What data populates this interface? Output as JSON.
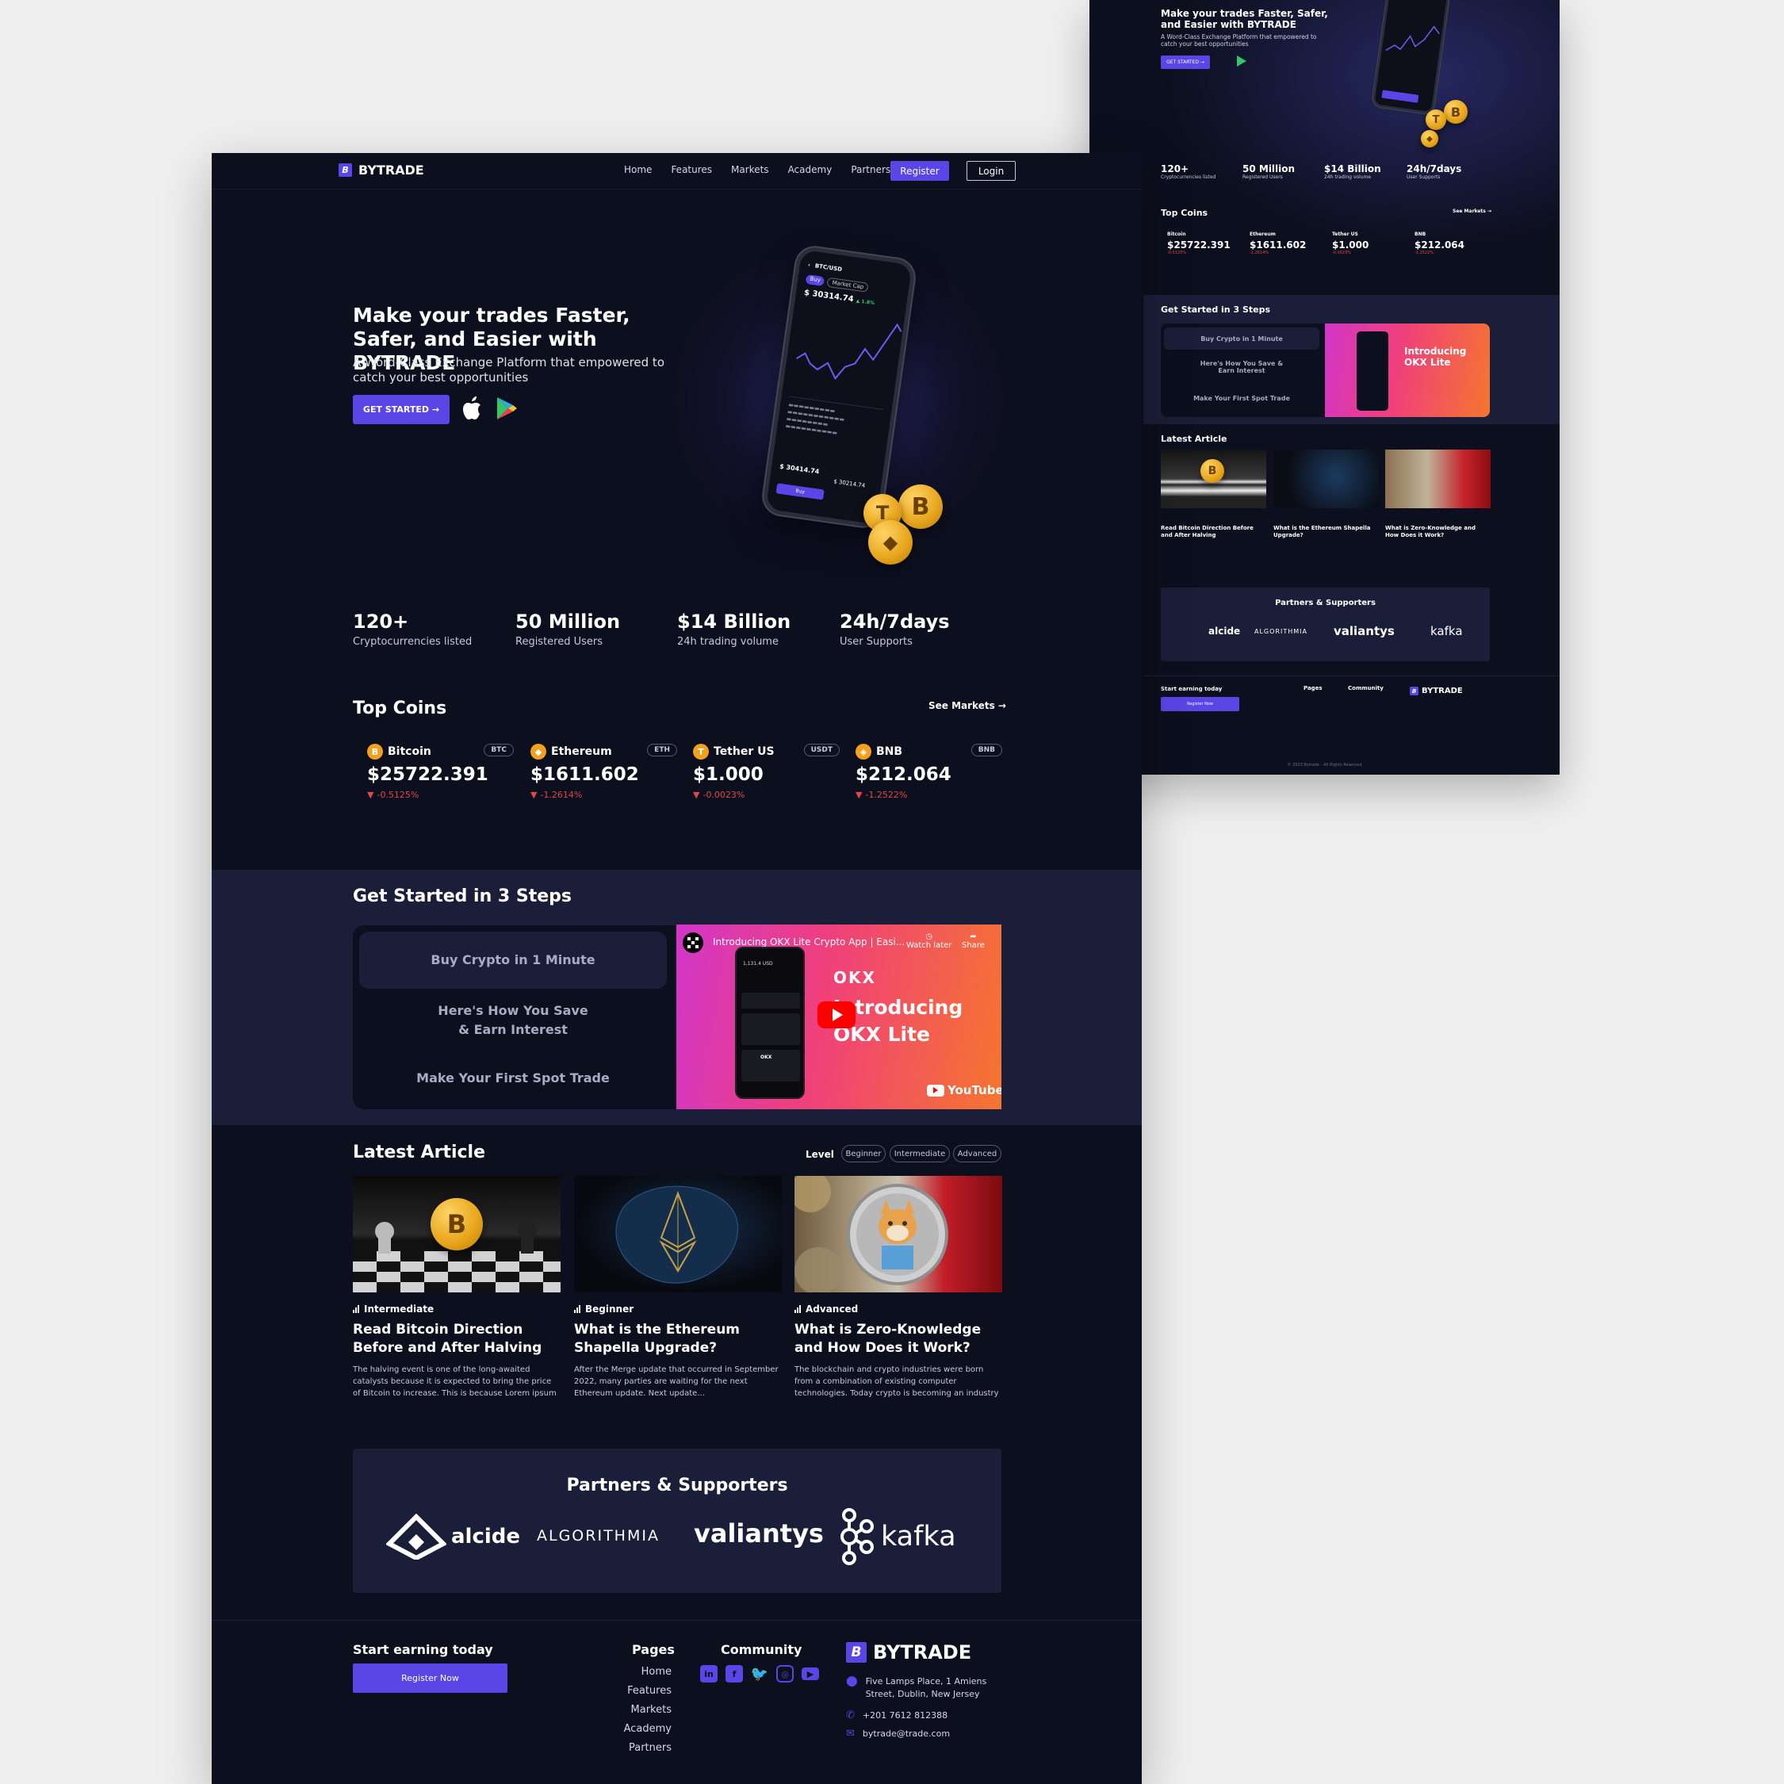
{
  "brand": "BYTRADE",
  "brand_letter": "B",
  "nav": {
    "links": [
      "Home",
      "Features",
      "Markets",
      "Academy",
      "Partners"
    ],
    "register": "Register",
    "login": "Login"
  },
  "hero": {
    "title": "Make your trades Faster, Safer, and Easier with BYTRADE",
    "subtitle": "A Word-Class Exchange Platform that empowered to catch your best opportunities",
    "cta": "GET STARTED →",
    "phone": {
      "pair": "BTC/USD",
      "price": "$ 30314.74",
      "change": "▲ 1.8%",
      "tab_buy": "Buy",
      "tab_market": "Market Cap",
      "bottom_price": "$ 30414.74",
      "bottom_price2": "$ 30214.74",
      "buy_btn": "Buy"
    }
  },
  "stats": [
    {
      "value": "120+",
      "label": "Cryptocurrencies listed"
    },
    {
      "value": "50 Million",
      "label": "Registered Users"
    },
    {
      "value": "$14 Billion",
      "label": "24h trading volume"
    },
    {
      "value": "24h/7days",
      "label": "User Supports"
    }
  ],
  "top_coins": {
    "title": "Top Coins",
    "see_markets": "See Markets →",
    "coins": [
      {
        "name": "Bitcoin",
        "symbol": "BTC",
        "price": "$25722.391",
        "change": "-0.5125%",
        "icon": "B",
        "color": "#f2a11f"
      },
      {
        "name": "Ethereum",
        "symbol": "ETH",
        "price": "$1611.602",
        "change": "-1.2614%",
        "icon": "◆",
        "color": "#f2a11f"
      },
      {
        "name": "Tether US",
        "symbol": "USDT",
        "price": "$1.000",
        "change": "-0.0023%",
        "icon": "T",
        "color": "#f2a11f"
      },
      {
        "name": "BNB",
        "symbol": "BNB",
        "price": "$212.064",
        "change": "-1.2522%",
        "icon": "◈",
        "color": "#f2a11f"
      }
    ]
  },
  "steps": {
    "title": "Get Started in 3 Steps",
    "items": [
      "Buy Crypto in 1 Minute",
      "Here's How You Save & Earn Interest",
      "Make Your First Spot Trade"
    ],
    "video": {
      "title": "Introducing OKX Lite Crypto App | Easi...",
      "watch_later": "Watch later",
      "share": "Share",
      "brand": "OKX",
      "headline_1": "Introducing",
      "headline_2": "OKX Lite",
      "youtube": "YouTube",
      "balance": "1,131.4 USD",
      "screen_brand": "OKX"
    }
  },
  "articles": {
    "title": "Latest Article",
    "level_label": "Level",
    "levels": [
      "Beginner",
      "Intermediate",
      "Advanced"
    ],
    "items": [
      {
        "level": "Intermediate",
        "title": "Read Bitcoin Direction Before and After Halving",
        "excerpt": "The halving event is one of the long-awaited catalysts because it is expected to bring the price of Bitcoin to increase. This is because Lorem ipsum dolor, sit amet..."
      },
      {
        "level": "Beginner",
        "title": "What is the Ethereum Shapella Upgrade?",
        "excerpt": "After the Merge update that occurred in September 2022, many parties are waiting for the next Ethereum update. Next update..."
      },
      {
        "level": "Advanced",
        "title": "What is Zero-Knowledge and How Does it Work?",
        "excerpt": "The blockchain and crypto industries were born from a combination of existing computer technologies. Today crypto is becoming an industry for various teams of..."
      }
    ]
  },
  "partners": {
    "title": "Partners & Supporters",
    "logos": [
      "alcide",
      "ALGORITHMIA",
      "valiantys",
      "kafka"
    ]
  },
  "footer": {
    "cta_title": "Start earning today",
    "cta_button": "Register Now",
    "pages_title": "Pages",
    "pages": [
      "Home",
      "Features",
      "Markets",
      "Academy",
      "Partners"
    ],
    "community_title": "Community",
    "social_icons": [
      "linkedin-icon",
      "facebook-icon",
      "twitter-icon",
      "instagram-icon",
      "youtube-icon"
    ],
    "address": "Five Lamps Place, 1 Amiens Street, Dublin, New Jersey",
    "phone": "+201 7612 812388",
    "email": "bytrade@trade.com",
    "copyright": "© 2023 Bytrade - All Rights Reserved"
  },
  "colors": {
    "bg": "#0c0f1d",
    "panel": "#1a1e38",
    "accent": "#5a45e6",
    "negative": "#e04848",
    "canvas": "#efefef"
  }
}
